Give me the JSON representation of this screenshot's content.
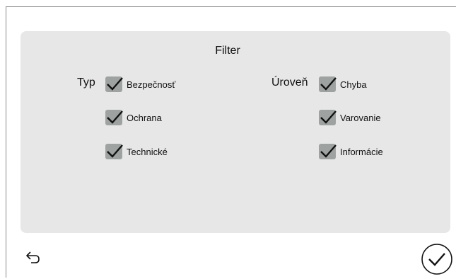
{
  "panel": {
    "title": "Filter"
  },
  "typ": {
    "label": "Typ",
    "items": [
      {
        "label": "Bezpečnosť",
        "checked": true
      },
      {
        "label": "Ochrana",
        "checked": true
      },
      {
        "label": "Technické",
        "checked": true
      }
    ]
  },
  "uroven": {
    "label": "Úroveň",
    "items": [
      {
        "label": "Chyba",
        "checked": true
      },
      {
        "label": "Varovanie",
        "checked": true
      },
      {
        "label": "Informácie",
        "checked": true
      }
    ]
  },
  "icons": {
    "back": "back-arrow-icon",
    "confirm": "circle-check-icon",
    "check": "checkmark-icon"
  },
  "colors": {
    "panel_bg": "#e6e7e6",
    "checkbox_bg": "#9ea3a2",
    "check_mark": "#111111"
  }
}
